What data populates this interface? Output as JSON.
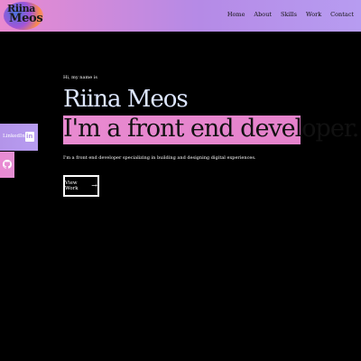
{
  "nav": {
    "logo_line1": "Riina",
    "logo_line2": "Meos",
    "links": [
      "Home",
      "About",
      "Skills",
      "Work",
      "Contact"
    ]
  },
  "hero": {
    "greeting": "Hi, my name is",
    "name": "Riina Meos",
    "role": "I'm a front end developer.",
    "intro": "I'm a front end developer specializing in building and designing digital experiences.",
    "cta_label": "View Work",
    "cta_icon": "arrow-right-icon"
  },
  "social": {
    "linkedin_label": "LinkedIn",
    "linkedin_icon": "linkedin-icon",
    "github_icon": "github-icon"
  },
  "colors": {
    "background": "#000000",
    "accent_pink": "#e88ad0",
    "accent_purple": "#b79cf1",
    "name_color": "#dde6ff"
  }
}
